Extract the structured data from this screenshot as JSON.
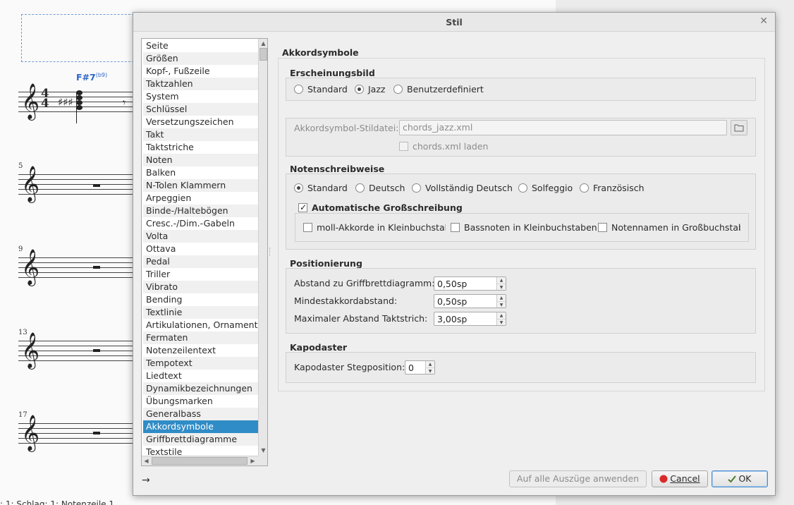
{
  "score": {
    "chord_root": "F#7",
    "chord_ext": "(b9)",
    "measure_numbers": [
      "5",
      "9",
      "13",
      "17"
    ],
    "time_signature": "4/4",
    "status_text": ": 1; Schlag: 1; Notenzeile 1"
  },
  "dialog": {
    "title": "Stil",
    "close_glyph": "✕",
    "nav_items": [
      "Seite",
      "Größen",
      "Kopf-, Fußzeile",
      "Taktzahlen",
      "System",
      "Schlüssel",
      "Versetzungszeichen",
      "Takt",
      "Taktstriche",
      "Noten",
      "Balken",
      "N-Tolen Klammern",
      "Arpeggien",
      "Binde-/Haltebögen",
      "Cresc.-/Dim.-Gabeln",
      "Volta",
      "Ottava",
      "Pedal",
      "Triller",
      "Vibrato",
      "Bending",
      "Textlinie",
      "Artikulationen, Ornamente",
      "Fermaten",
      "Notenzeilentext",
      "Tempotext",
      "Liedtext",
      "Dynamikbezeichnungen",
      "Übungsmarken",
      "Generalbass",
      "Akkordsymbole",
      "Griffbrettdiagramme",
      "Textstile"
    ],
    "selected_item": "Akkordsymbole",
    "page_heading": "Akkordsymbole",
    "appearance": {
      "title": "Erscheinungsbild",
      "options": [
        "Standard",
        "Jazz",
        "Benutzerdefiniert"
      ],
      "selected": "Jazz"
    },
    "style_file": {
      "label": "Akkordsymbol-Stildatei:",
      "value": "chords_jazz.xml",
      "load_xml_label": "chords.xml laden"
    },
    "note_spelling": {
      "title": "Notenschreibweise",
      "options": [
        "Standard",
        "Deutsch",
        "Vollständig Deutsch",
        "Solfeggio",
        "Französisch"
      ],
      "selected": "Standard",
      "auto_caps_label": "Automatische Großschreibung",
      "minor_lower_label": "moll-Akkorde in Kleinbuchstab",
      "bass_lower_label": "Bassnoten in Kleinbuchstaben",
      "note_names_upper_label": "Notennamen in Großbuchstaben"
    },
    "positioning": {
      "title": "Positionierung",
      "fretboard_distance_label": "Abstand zu Griffbrettdiagramm:",
      "fretboard_distance_value": "0,50sp",
      "min_chord_distance_label": "Mindestakkordabstand:",
      "min_chord_distance_value": "0,50sp",
      "max_barline_distance_label": "Maximaler Abstand Taktstrich:",
      "max_barline_distance_value": "3,00sp"
    },
    "capo": {
      "title": "Kapodaster",
      "position_label": "Kapodaster Stegposition:",
      "position_value": "0"
    },
    "footer": {
      "arrow_glyph": "→",
      "apply_all_label": "Auf alle Auszüge anwenden",
      "cancel_label": "Cancel",
      "ok_label": "OK"
    }
  }
}
